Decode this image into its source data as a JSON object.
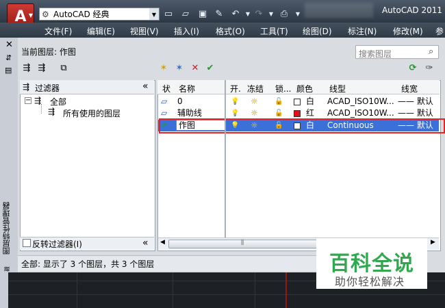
{
  "titlebar": {
    "app_icon_label": "A",
    "workspace": "AutoCAD 经典",
    "app_title": "AutoCAD 2011"
  },
  "menu": [
    "文件(F)",
    "编辑(E)",
    "视图(V)",
    "插入(I)",
    "格式(O)",
    "工具(T)",
    "绘图(D)",
    "标注(N)",
    "修改(M)",
    "参"
  ],
  "palette": {
    "side_title": "图层特性管理器",
    "current_layer": "当前图层: 作图",
    "search_placeholder": "搜索图层"
  },
  "filters": {
    "header": "过滤器",
    "tree": [
      {
        "label": "全部",
        "level": 0,
        "expander": "−"
      },
      {
        "label": "所有使用的图层",
        "level": 1
      }
    ],
    "invert_label": "反转过滤器(I)"
  },
  "grid": {
    "columns": [
      "状",
      "名称",
      "开.",
      "冻结",
      "锁...",
      "颜色",
      "线型",
      "线宽"
    ],
    "rows": [
      {
        "status": "▱",
        "name": "0",
        "on": "💡",
        "freeze": "☼",
        "lock": "🔓",
        "color_name": "白",
        "color_hex": "#ffffff",
        "linetype": "ACAD_ISO10W...",
        "lineweight": "—— 默认"
      },
      {
        "status": "▱",
        "name": "辅助线",
        "on": "💡",
        "freeze": "☼",
        "lock": "🔓",
        "color_name": "红",
        "color_hex": "#e0101a",
        "linetype": "ACAD_ISO10W...",
        "lineweight": "—— 默认"
      },
      {
        "status": "✔",
        "name": "作图",
        "on": "💡",
        "freeze": "☼",
        "lock": "🔓",
        "color_name": "白",
        "color_hex": "#ffffff",
        "linetype": "Continuous",
        "lineweight": "—— 默认"
      }
    ]
  },
  "status_text": "全部: 显示了 3 个图层，共 3 个图层",
  "watermark": {
    "title": "百科全说",
    "subtitle": "助你轻松解决"
  },
  "colors": {
    "selection": "#3b70d8",
    "highlight_outline": "#e0242a",
    "watermark_green": "#2fa84f"
  }
}
